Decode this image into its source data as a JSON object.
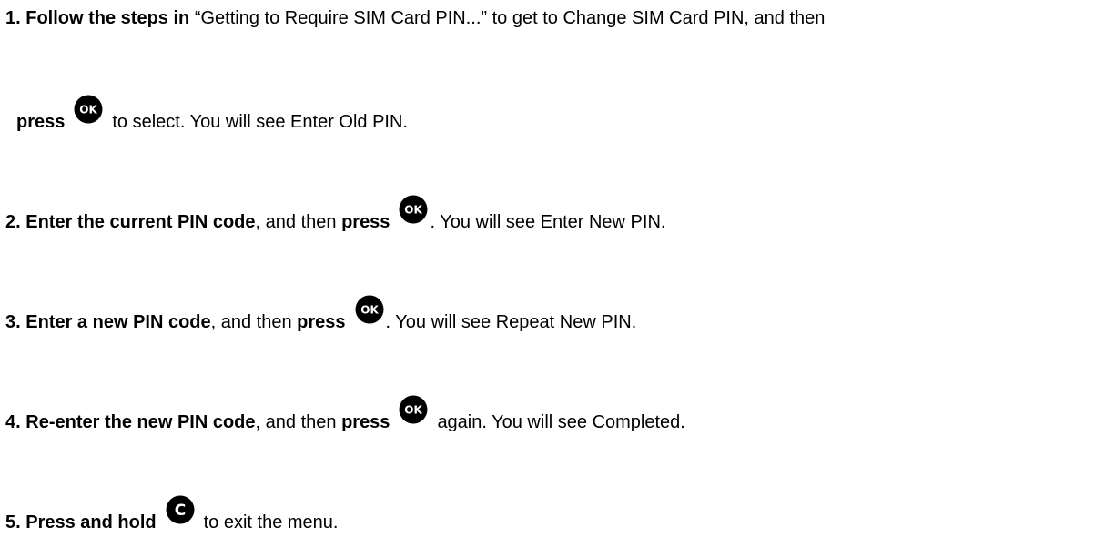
{
  "steps": [
    {
      "number": "1.",
      "bold_lead": "Follow the steps in",
      "text_a": "“Getting to Require SIM Card PIN...” to get to Change SIM Card PIN, and then",
      "cont_bold": "press",
      "text_b": "to select. You will see Enter Old PIN."
    },
    {
      "number": "2.",
      "bold_lead": "Enter the current PIN code",
      "text_a": ", and then",
      "bold_press": "press",
      "text_b": ". You will see Enter New PIN."
    },
    {
      "number": "3.",
      "bold_lead": "Enter a new PIN code",
      "text_a": ", and then",
      "bold_press": "press",
      "text_b": ". You will see Repeat New PIN."
    },
    {
      "number": "4.",
      "bold_lead": "Re-enter the new PIN code",
      "text_a": ", and then",
      "bold_press": "press",
      "text_b": "again. You will see Completed."
    },
    {
      "number": "5.",
      "bold_lead": "Press and hold",
      "text_b": "to exit the menu."
    }
  ],
  "icons": {
    "ok_label": "OK",
    "c_label": "C",
    "icon_color": "#000000",
    "icon_text_color": "#ffffff"
  }
}
